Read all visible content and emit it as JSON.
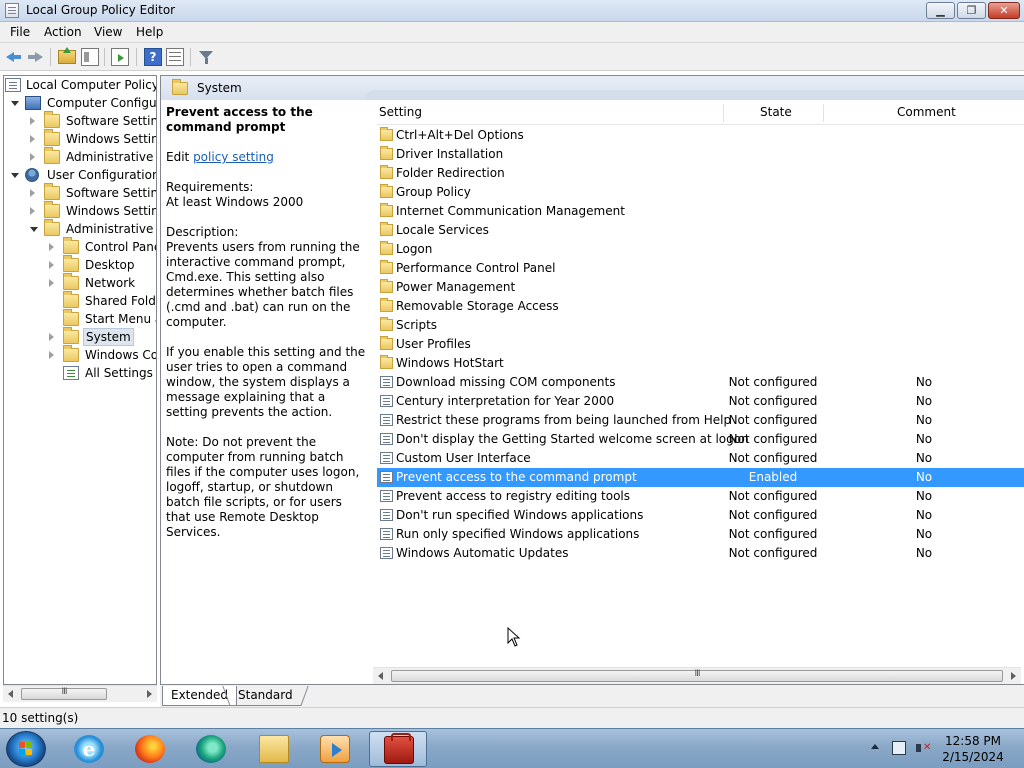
{
  "window": {
    "title": "Local Group Policy Editor",
    "min_glyph": "▁",
    "max_glyph": "❐",
    "close_glyph": "✕"
  },
  "menu": [
    "File",
    "Action",
    "View",
    "Help"
  ],
  "toolbar": {
    "help_glyph": "?"
  },
  "tree": [
    {
      "label": "Local Computer Policy",
      "level": 0,
      "expander": "none",
      "icon": "policy-doc-icon"
    },
    {
      "label": "Computer Configura",
      "level": 1,
      "expander": "down",
      "icon": "computer-icon"
    },
    {
      "label": "Software Settings",
      "level": 2,
      "expander": "right",
      "icon": "folder-icon"
    },
    {
      "label": "Windows Setting",
      "level": 2,
      "expander": "right",
      "icon": "folder-icon"
    },
    {
      "label": "Administrative Te",
      "level": 2,
      "expander": "right",
      "icon": "folder-icon"
    },
    {
      "label": "User Configuration",
      "level": 1,
      "expander": "down",
      "icon": "user-icon"
    },
    {
      "label": "Software Settings",
      "level": 2,
      "expander": "right",
      "icon": "folder-icon"
    },
    {
      "label": "Windows Setting",
      "level": 2,
      "expander": "right",
      "icon": "folder-icon"
    },
    {
      "label": "Administrative Te",
      "level": 2,
      "expander": "down",
      "icon": "folder-icon"
    },
    {
      "label": "Control Panel",
      "level": 3,
      "expander": "right",
      "icon": "folder-icon"
    },
    {
      "label": "Desktop",
      "level": 3,
      "expander": "right",
      "icon": "folder-icon"
    },
    {
      "label": "Network",
      "level": 3,
      "expander": "right",
      "icon": "folder-icon"
    },
    {
      "label": "Shared Folder",
      "level": 3,
      "expander": "none",
      "icon": "folder-icon"
    },
    {
      "label": "Start Menu ar",
      "level": 3,
      "expander": "none",
      "icon": "folder-icon"
    },
    {
      "label": "System",
      "level": 3,
      "expander": "right",
      "icon": "folder-icon",
      "selected": true
    },
    {
      "label": "Windows Cor",
      "level": 3,
      "expander": "right",
      "icon": "folder-icon"
    },
    {
      "label": "All Settings",
      "level": 3,
      "expander": "none",
      "icon": "all-settings-icon"
    }
  ],
  "scroll_grip": "III",
  "right_header": {
    "title": "System"
  },
  "description": {
    "policy_title": "Prevent access to the command prompt",
    "edit_prefix": "Edit ",
    "edit_link": "policy setting ",
    "requirements_label": "Requirements:",
    "requirements_value": "At least Windows 2000",
    "description_label": "Description:",
    "description_text": "Prevents users from running the interactive command prompt, Cmd.exe. This setting also determines whether batch files (.cmd and .bat) can run on the computer.",
    "enable_text": "If you enable this setting and the user tries to open a command window, the system displays a message explaining that a setting prevents the action.",
    "note_text": "Note: Do not prevent the computer from running batch files if the computer uses logon, logoff, startup, or shutdown batch file scripts, or for users that use Remote Desktop Services."
  },
  "columns": {
    "setting": "Setting",
    "state": "State",
    "comment": "Comment"
  },
  "rows": [
    {
      "name": "Ctrl+Alt+Del Options",
      "type": "folder",
      "state": "",
      "comment": ""
    },
    {
      "name": "Driver Installation",
      "type": "folder",
      "state": "",
      "comment": ""
    },
    {
      "name": "Folder Redirection",
      "type": "folder",
      "state": "",
      "comment": ""
    },
    {
      "name": "Group Policy",
      "type": "folder",
      "state": "",
      "comment": ""
    },
    {
      "name": "Internet Communication Management",
      "type": "folder",
      "state": "",
      "comment": ""
    },
    {
      "name": "Locale Services",
      "type": "folder",
      "state": "",
      "comment": ""
    },
    {
      "name": "Logon",
      "type": "folder",
      "state": "",
      "comment": ""
    },
    {
      "name": "Performance Control Panel",
      "type": "folder",
      "state": "",
      "comment": ""
    },
    {
      "name": "Power Management",
      "type": "folder",
      "state": "",
      "comment": ""
    },
    {
      "name": "Removable Storage Access",
      "type": "folder",
      "state": "",
      "comment": ""
    },
    {
      "name": "Scripts",
      "type": "folder",
      "state": "",
      "comment": ""
    },
    {
      "name": "User Profiles",
      "type": "folder",
      "state": "",
      "comment": ""
    },
    {
      "name": "Windows HotStart",
      "type": "folder",
      "state": "",
      "comment": ""
    },
    {
      "name": "Download missing COM components",
      "type": "setting",
      "state": "Not configured",
      "comment": "No"
    },
    {
      "name": "Century interpretation for Year 2000",
      "type": "setting",
      "state": "Not configured",
      "comment": "No"
    },
    {
      "name": "Restrict these programs from being launched from Help",
      "type": "setting",
      "state": "Not configured",
      "comment": "No"
    },
    {
      "name": "Don't display the Getting Started welcome screen at logon",
      "type": "setting",
      "state": "Not configured",
      "comment": "No"
    },
    {
      "name": "Custom User Interface",
      "type": "setting",
      "state": "Not configured",
      "comment": "No"
    },
    {
      "name": "Prevent access to the command prompt",
      "type": "setting",
      "state": "Enabled",
      "comment": "No",
      "selected": true
    },
    {
      "name": "Prevent access to registry editing tools",
      "type": "setting",
      "state": "Not configured",
      "comment": "No"
    },
    {
      "name": "Don't run specified Windows applications",
      "type": "setting",
      "state": "Not configured",
      "comment": "No"
    },
    {
      "name": "Run only specified Windows applications",
      "type": "setting",
      "state": "Not configured",
      "comment": "No"
    },
    {
      "name": "Windows Automatic Updates",
      "type": "setting",
      "state": "Not configured",
      "comment": "No"
    }
  ],
  "tabs": {
    "extended": "Extended",
    "standard": "Standard"
  },
  "status": {
    "text": "10 setting(s)"
  },
  "taskbar": {
    "apps": [
      "internet-explorer-icon",
      "firefox-icon",
      "edge-icon",
      "file-explorer-icon",
      "media-player-icon",
      "group-policy-editor-icon"
    ],
    "active_app": "group-policy-editor-icon",
    "ie_glyph": "e"
  },
  "clock": {
    "time": "12:58 PM",
    "date": "2/15/2024"
  },
  "colors": {
    "selection": "#3399ff",
    "link": "#1a5fb4"
  }
}
